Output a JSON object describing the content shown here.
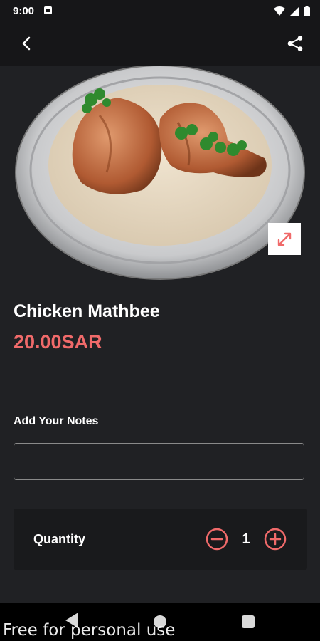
{
  "status_bar": {
    "time": "9:00",
    "icons": [
      "notification-icon",
      "wifi-icon",
      "signal-icon",
      "battery-icon"
    ]
  },
  "app_bar": {
    "icons": [
      "back-arrow-icon",
      "share-icon"
    ]
  },
  "hero": {
    "image": "chicken-mathbee-dish-photo",
    "expand_icon": "expand-icon"
  },
  "product": {
    "name": "Chicken Mathbee",
    "price": "20.00SAR"
  },
  "notes": {
    "label": "Add Your Notes",
    "value": "",
    "placeholder": ""
  },
  "quantity": {
    "label": "Quantity",
    "value": "1",
    "icons": [
      "minus-circle-icon",
      "plus-circle-icon"
    ]
  },
  "navigation_bar": {
    "icons": [
      "nav-back-icon",
      "nav-home-icon",
      "nav-recents-icon"
    ]
  },
  "watermark": "Free for personal use",
  "colors": {
    "accent": "#f06a6a",
    "background": "#202124",
    "bar": "#161618"
  }
}
